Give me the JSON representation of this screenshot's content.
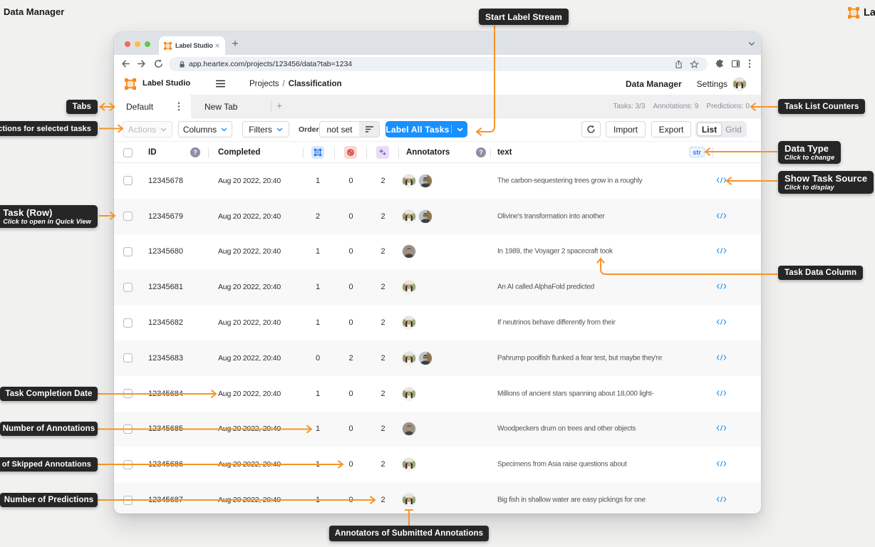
{
  "page": {
    "title": "Data Manager",
    "brand_partial": "La"
  },
  "browser": {
    "tab_title": "Label Studio",
    "url": "app.heartex.com/projects/123456/data?tab=1234"
  },
  "app": {
    "brand": "Label Studio",
    "breadcrumb": {
      "parent": "Projects",
      "separator": "/",
      "current": "Classification"
    },
    "nav": {
      "data_manager": "Data Manager",
      "settings": "Settings"
    }
  },
  "tabs": {
    "active": "Default",
    "inactive": "New Tab",
    "counters": [
      "Tasks: 3/3",
      "Annotations: 9",
      "Predictions: 0"
    ]
  },
  "toolbar": {
    "actions": "Actions",
    "columns": "Columns",
    "filters": "Filters",
    "order_label": "Order",
    "order_value": "not set",
    "label_all_tasks": "Label All Tasks",
    "import": "Import",
    "export": "Export",
    "list": "List",
    "grid": "Grid"
  },
  "table": {
    "headers": {
      "id": "ID",
      "completed": "Completed",
      "annotators": "Annotators",
      "text": "text"
    },
    "type_badge": "str",
    "icon_columns": [
      "annotations-icon",
      "skipped-annotations-icon",
      "predictions-icon"
    ],
    "rows": [
      {
        "id": "12345678",
        "completed": "Aug 20 2022, 20:40",
        "annotations": "1",
        "skipped": "0",
        "predictions": "2",
        "annotators": [
          "woman",
          "man-glasses"
        ],
        "text": "The carbon-sequestering trees grow in a roughly"
      },
      {
        "id": "12345679",
        "completed": "Aug 20 2022, 20:40",
        "annotations": "2",
        "skipped": "0",
        "predictions": "2",
        "annotators": [
          "woman",
          "man-glasses"
        ],
        "text": "Olivine's transformation into another"
      },
      {
        "id": "12345680",
        "completed": "Aug 20 2022, 20:40",
        "annotations": "1",
        "skipped": "0",
        "predictions": "2",
        "annotators": [
          "man-dark"
        ],
        "text": "In 1989, the Voyager 2 spacecraft took"
      },
      {
        "id": "12345681",
        "completed": "Aug 20 2022, 20:40",
        "annotations": "1",
        "skipped": "0",
        "predictions": "2",
        "annotators": [
          "woman"
        ],
        "text": "An AI called AlphaFold predicted"
      },
      {
        "id": "12345682",
        "completed": "Aug 20 2022, 20:40",
        "annotations": "1",
        "skipped": "0",
        "predictions": "2",
        "annotators": [
          "woman"
        ],
        "text": "If neutrinos behave differently from their"
      },
      {
        "id": "12345683",
        "completed": "Aug 20 2022, 20:40",
        "annotations": "0",
        "skipped": "2",
        "predictions": "2",
        "annotators": [
          "woman",
          "man-glasses"
        ],
        "text": "Pahrump poolfish flunked a fear test, but maybe they're"
      },
      {
        "id": "12345684",
        "completed": "Aug 20 2022, 20:40",
        "annotations": "1",
        "skipped": "0",
        "predictions": "2",
        "annotators": [
          "woman"
        ],
        "text": "Millions of ancient stars spanning about 18,000 light-"
      },
      {
        "id": "12345685",
        "completed": "Aug 20 2022, 20:40",
        "annotations": "1",
        "skipped": "0",
        "predictions": "2",
        "annotators": [
          "man-dark"
        ],
        "text": "Woodpeckers drum on trees and other objects"
      },
      {
        "id": "12345686",
        "completed": "Aug 20 2022, 20:40",
        "annotations": "1",
        "skipped": "0",
        "predictions": "2",
        "annotators": [
          "woman"
        ],
        "text": "Specimens from Asia raise questions about"
      },
      {
        "id": "12345687",
        "completed": "Aug 20 2022, 20:40",
        "annotations": "1",
        "skipped": "0",
        "predictions": "2",
        "annotators": [
          "woman"
        ],
        "text": "Big fish in shallow water are easy pickings for one"
      }
    ]
  },
  "callouts": {
    "start_label_stream": {
      "title": "Start Label Stream"
    },
    "tabs": {
      "title": "Tabs"
    },
    "actions_for_selected": {
      "title": "Actions for selected tasks"
    },
    "task_row": {
      "title": "Task (Row)",
      "subtitle": "Click to open in Quick View"
    },
    "task_list_counters": {
      "title": "Task List Counters"
    },
    "data_type": {
      "title": "Data Type",
      "subtitle": "Click to change"
    },
    "show_task_source": {
      "title": "Show Task Source",
      "subtitle": "Click to display"
    },
    "task_data_column": {
      "title": "Task Data Column"
    },
    "task_completion_date": {
      "title": "Task Completion Date"
    },
    "number_of_annotations": {
      "title": "Number of Annotations"
    },
    "number_of_skipped_annotations": {
      "title": "Number of Skipped Annotations"
    },
    "number_of_predictions": {
      "title": "Number of Predictions"
    },
    "annotators_of_submitted": {
      "title": "Annotators of Submitted Annotations"
    }
  },
  "colors": {
    "arrow_orange": "#F5952B",
    "logo_orange": "#F6891E",
    "primary_blue": "#1890FF",
    "callout_bg": "#262626",
    "page_bg": "#F1F1F0"
  }
}
